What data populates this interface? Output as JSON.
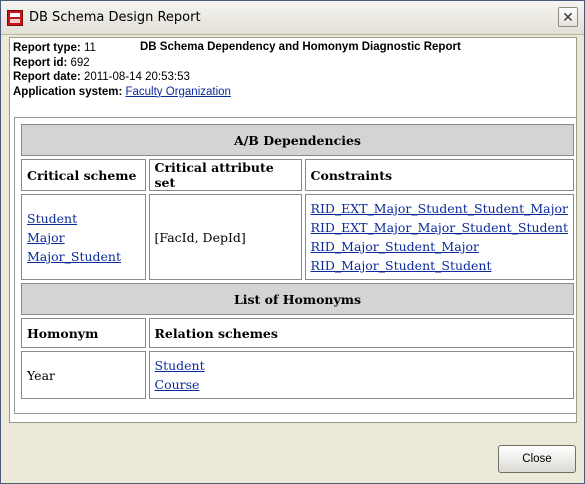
{
  "window": {
    "title": "DB Schema Design Report",
    "close_glyph": "✕"
  },
  "meta": {
    "type_label": "Report type:",
    "type_value": "11",
    "report_title": "DB Schema Dependency and Homonym Diagnostic Report",
    "id_label": "Report id:",
    "id_value": "692",
    "date_label": "Report date:",
    "date_value": "2011-08-14 20:53:53",
    "app_label": "Application system:",
    "app_value": "Faculty Organization"
  },
  "ab": {
    "title": "A/B Dependencies",
    "headers": [
      "Critical scheme",
      "Critical attribute set",
      "Constraints"
    ],
    "schemes": [
      "Student",
      "Major",
      "Major_Student"
    ],
    "attribute_set": "[FacId, DepId]",
    "constraints": [
      "RID_EXT_Major_Student_Student_Major",
      "RID_EXT_Major_Major_Student_Student",
      "RID_Major_Student_Major",
      "RID_Major_Student_Student"
    ]
  },
  "homonyms": {
    "title": "List of Homonyms",
    "headers": [
      "Homonym",
      "Relation schemes"
    ],
    "homonym": "Year",
    "schemes": [
      "Student",
      "Course"
    ]
  },
  "buttons": {
    "close": "Close"
  }
}
